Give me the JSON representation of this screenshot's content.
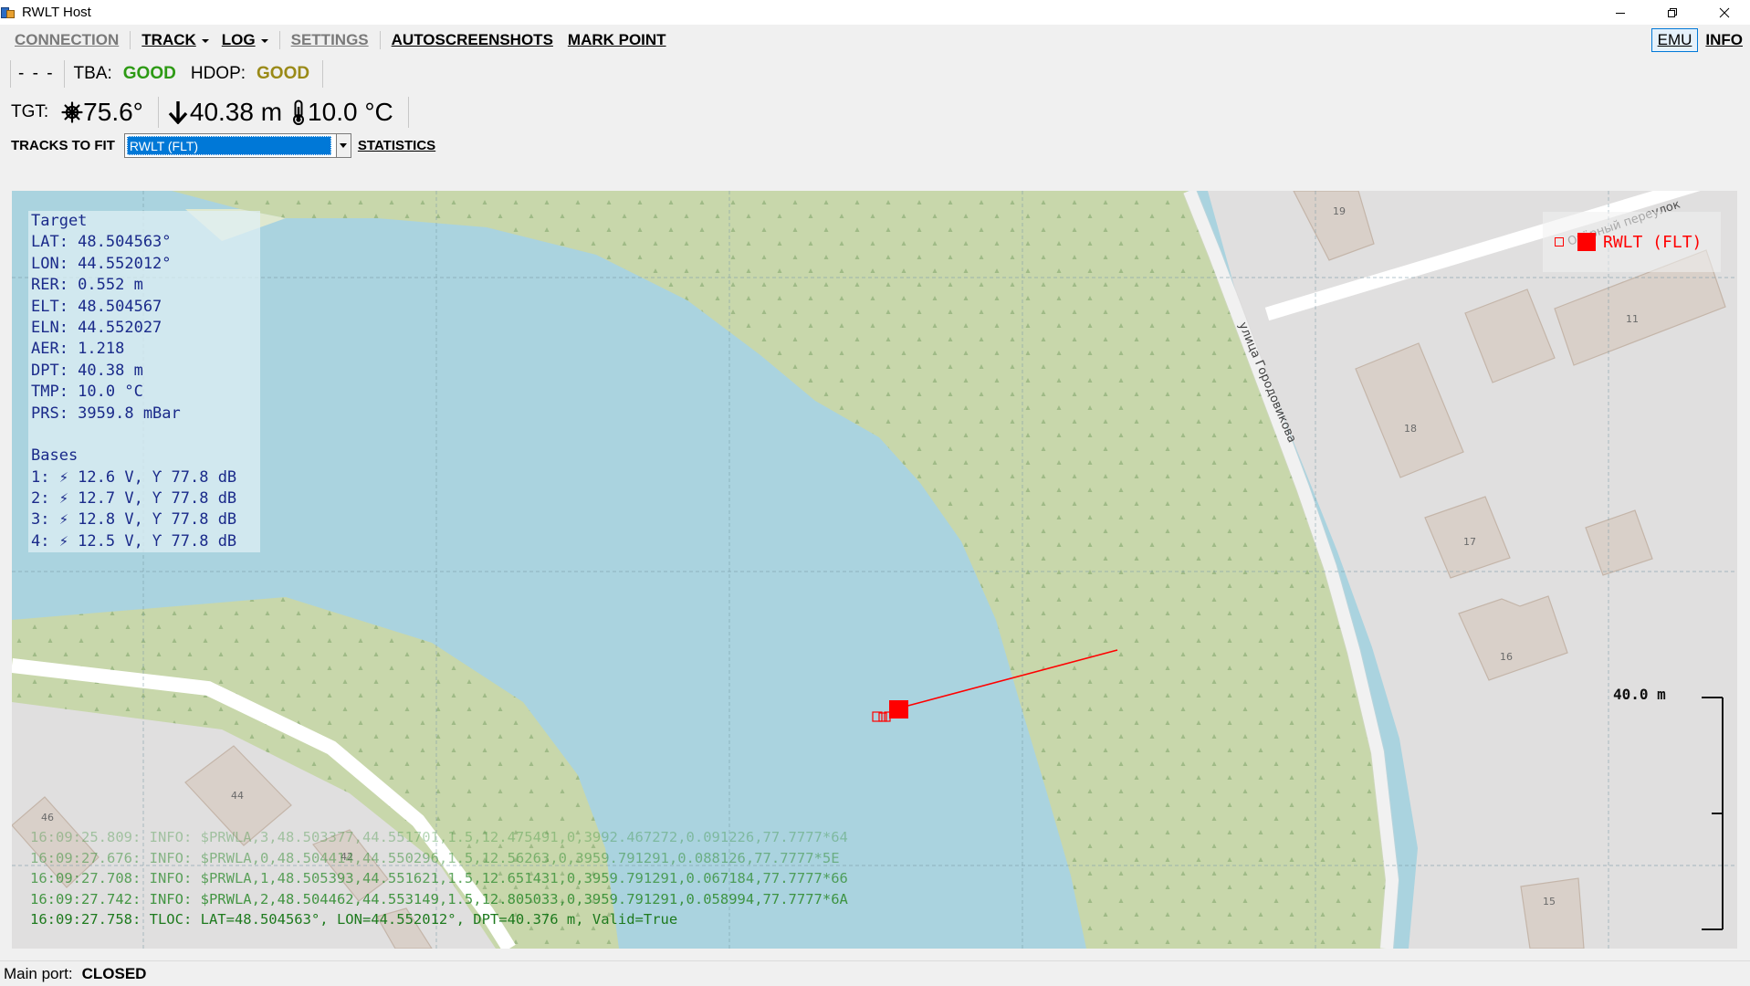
{
  "window": {
    "title": "RWLT Host"
  },
  "menu": {
    "connection": "CONNECTION",
    "track": "TRACK",
    "log": "LOG",
    "settings": "SETTINGS",
    "autoscreenshots": "AUTOSCREENSHOTS",
    "mark_point": "MARK POINT",
    "emu": "EMU",
    "info": "INFO"
  },
  "status_row": {
    "dashes": "- - -",
    "tba_label": "TBA:",
    "tba_value": "GOOD",
    "hdop_label": "HDOP:",
    "hdop_value": "GOOD"
  },
  "target_row": {
    "label": "TGT:",
    "heading": "75.6°",
    "depth": "40.38 m",
    "temperature": "10.0 °C"
  },
  "tracks": {
    "label": "TRACKS TO FIT",
    "selected": "RWLT (FLT)",
    "statistics": "STATISTICS"
  },
  "info_panel": {
    "lines": [
      "Target",
      "LAT: 48.504563°",
      "LON: 44.552012°",
      "RER: 0.552 m",
      "ELT: 48.504567",
      "ELN: 44.552027",
      "AER: 1.218",
      "DPT: 40.38 m",
      "TMP: 10.0 °C",
      "PRS: 3959.8 mBar",
      "",
      "Bases",
      "1: ⚡ 12.6 V, Ƴ 77.8 dB",
      "2: ⚡ 12.7 V, Ƴ 77.8 dB",
      "3: ⚡ 12.8 V, Ƴ 77.8 dB",
      "4: ⚡ 12.5 V, Ƴ 77.8 dB"
    ]
  },
  "legend": {
    "label": "RWLT (FLT)"
  },
  "scale": {
    "label": "40.0 m"
  },
  "map_labels": {
    "street_1": "улица Городовикова",
    "street_2": "Озёрный переулок",
    "buildings": [
      "19",
      "11",
      "18",
      "17",
      "16",
      "15",
      "44",
      "46",
      "42"
    ]
  },
  "log": {
    "lines": [
      "16:09:25.809: INFO: $PRWLA,3,48.503377,44.551701,1.5,12.475491,0,3992.467272,0.091226,77.7777*64",
      "16:09:27.676: INFO: $PRWLA,0,48.504414,44.550296,1.5,12.56263,0,3959.791291,0.088126,77.7777*5E",
      "16:09:27.708: INFO: $PRWLA,1,48.505393,44.551621,1.5,12.651431,0,3959.791291,0.067184,77.7777*66",
      "16:09:27.742: INFO: $PRWLA,2,48.504462,44.553149,1.5,12.805033,0,3959.791291,0.058994,77.7777*6A",
      "16:09:27.758: TLOC: LAT=48.504563°, LON=44.552012°, DPT=40.376 m, Valid=True"
    ]
  },
  "statusbar": {
    "label": "Main port:",
    "value": "CLOSED"
  },
  "colors": {
    "water": "#aad3df",
    "wood": "#c8d7ab",
    "good_tba": "#2d9a14",
    "good_hdop": "#9a8a18",
    "panel_text": "#1a2a8a",
    "track": "#ff0000",
    "log_text": "#2e8b2e"
  }
}
